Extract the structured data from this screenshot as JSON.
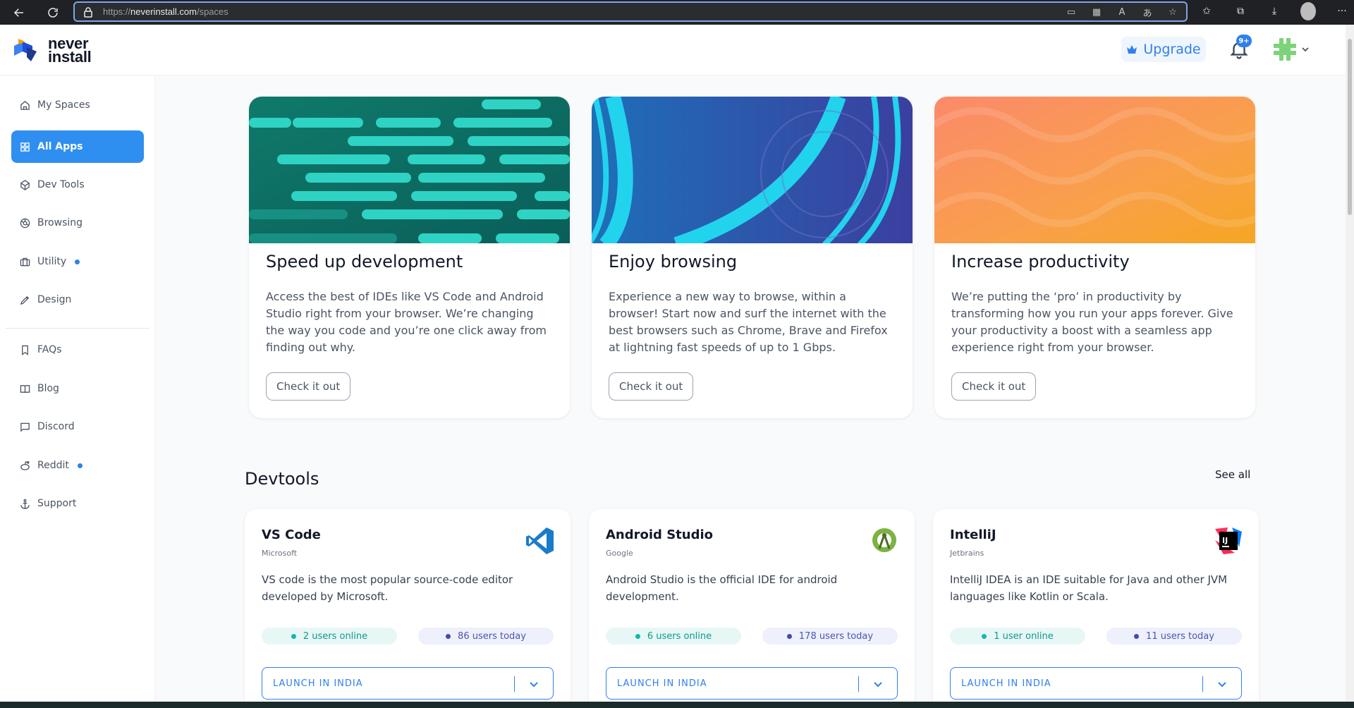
{
  "browser": {
    "url_prefix": "https://",
    "url_host": "neverinstall.com",
    "url_path": "/spaces"
  },
  "header": {
    "logo_line1": "never",
    "logo_line2": "install",
    "upgrade_label": "Upgrade",
    "notification_badge": "9+"
  },
  "sidebar": {
    "items": [
      {
        "label": "My Spaces"
      },
      {
        "label": "All Apps"
      },
      {
        "label": "Dev Tools"
      },
      {
        "label": "Browsing"
      },
      {
        "label": "Utility"
      },
      {
        "label": "Design"
      },
      {
        "label": "FAQs"
      },
      {
        "label": "Blog"
      },
      {
        "label": "Discord"
      },
      {
        "label": "Reddit"
      },
      {
        "label": "Support"
      }
    ]
  },
  "features": [
    {
      "title": "Speed up development",
      "body": "Access the best of IDEs like VS Code and Android Studio right from your browser. We’re changing the way you code and you’re one click away from finding out why.",
      "button": "Check it out"
    },
    {
      "title": "Enjoy browsing",
      "body": "Experience a new way to browse, within a browser! Start now and surf the internet with the best browsers such as Chrome, Brave and Firefox at lightning fast speeds of up to 1 Gbps.",
      "button": "Check it out"
    },
    {
      "title": "Increase productivity",
      "body": "We’re putting the ‘pro’ in productivity by transforming how you run your apps forever. Give your productivity a boost with a seamless app experience right from your browser.",
      "button": "Check it out"
    }
  ],
  "devtools": {
    "title": "Devtools",
    "see_all": "See all",
    "apps": [
      {
        "name": "VS Code",
        "vendor": "Microsoft",
        "description": "VS code is the most popular source-code editor developed by Microsoft.",
        "online": "2 users online",
        "today": "86 users today",
        "launch": "LAUNCH IN INDIA",
        "icon": "vscode-icon"
      },
      {
        "name": "Android Studio",
        "vendor": "Google",
        "description": "Android Studio is the official IDE for android development.",
        "online": "6 users online",
        "today": "178 users today",
        "launch": "LAUNCH IN INDIA",
        "icon": "android-studio-icon"
      },
      {
        "name": "IntelliJ",
        "vendor": "Jetbrains",
        "description": "IntelliJ IDEA is an IDE suitable for Java and other JVM languages like Kotlin or Scala.",
        "online": "1 user online",
        "today": "11 users today",
        "launch": "LAUNCH IN INDIA",
        "icon": "intellij-icon",
        "icon_text": "IJ"
      }
    ]
  },
  "colors": {
    "accent": "#2f80ed",
    "online": "#14b8a6",
    "today": "#3f4bb8"
  }
}
